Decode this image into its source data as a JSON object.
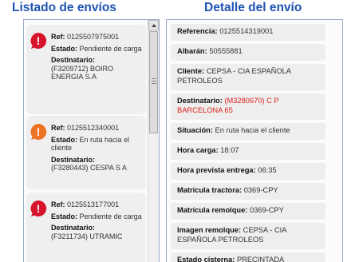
{
  "left_title": "Listado de envíos",
  "right_title": "Detalle del envío",
  "shipments": [
    {
      "status_color": "#d6132b",
      "icon": "alert-icon",
      "ref_label": "Ref:",
      "ref": "0125507975001",
      "estado_label": "Estado:",
      "estado": "Pendiente de carga",
      "dest_label": "Destinatario:",
      "dest": "(F3209712) BOIRO ENERGIA S.A"
    },
    {
      "status_color": "#ec7325",
      "icon": "alert-icon",
      "ref_label": "Ref:",
      "ref": "0125512340001",
      "estado_label": "Estado:",
      "estado": "En ruta hacia el cliente",
      "dest_label": "Destinatario:",
      "dest": "(F3280443) CESPA S A"
    },
    {
      "status_color": "#d6132b",
      "icon": "alert-icon",
      "ref_label": "Ref:",
      "ref": "0125513177001",
      "estado_label": "Estado:",
      "estado": "Pendiente de carga",
      "dest_label": "Destinatario:",
      "dest": "(F3211734) UTRAMIC"
    }
  ],
  "detail": {
    "referencia": {
      "label": "Referencia:",
      "value": "0125514319001"
    },
    "albaran": {
      "label": "Albarán:",
      "value": "50555881"
    },
    "cliente": {
      "label": "Cliente:",
      "value": "CEPSA - CIA ESPAÑOLA PETROLEOS"
    },
    "destinatario": {
      "label": "Destinatario:",
      "value": "(M3280670) C P BARCELONA 65"
    },
    "situacion": {
      "label": "Situación:",
      "value": "En ruta hacia el cliente"
    },
    "hora_carga": {
      "label": "Hora carga:",
      "value": "18:07"
    },
    "hora_prevista": {
      "label": "Hora prevista entrega:",
      "value": "06:35"
    },
    "matricula_tractora": {
      "label": "Matrícula tractora:",
      "value": "0369-CPY"
    },
    "matricula_remolque": {
      "label": "Matrícula remolque:",
      "value": "0369-CPY"
    },
    "imagen_remolque": {
      "label": "Imagen remolque:",
      "value": "CEPSA - CIA ESPAÑOLA PETROLEOS"
    },
    "estado_cisterna": {
      "label": "Estado cisterna:",
      "value": "PRECINTADA"
    }
  },
  "colors": {
    "title_blue": "#1f54b2",
    "highlight_red": "#e0201b"
  }
}
